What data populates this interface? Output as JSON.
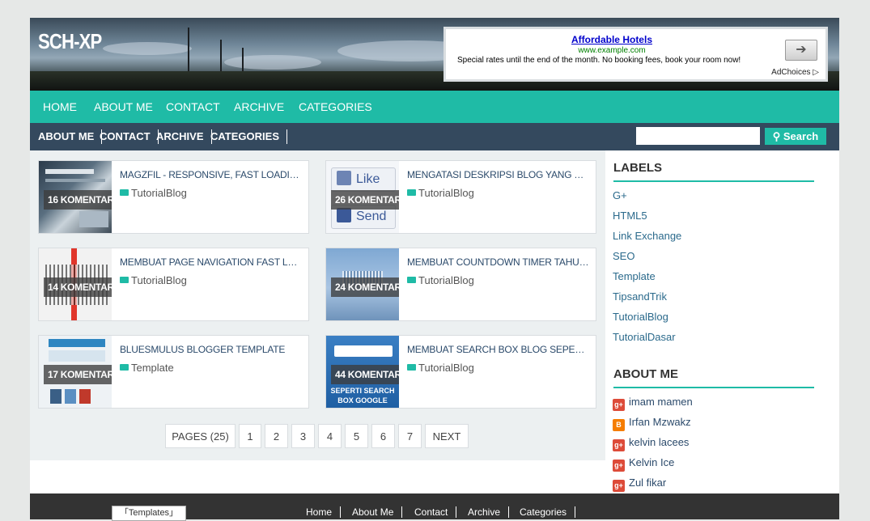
{
  "header": {
    "site_title": "SCH-XP",
    "ad": {
      "title": "Affordable Hotels",
      "url": "www.example.com",
      "description": "Special rates until the end of the month. No booking fees, book your room now!",
      "choices": "AdChoices"
    }
  },
  "nav_primary": [
    "HOME",
    "ABOUT ME",
    "CONTACT",
    "ARCHIVE",
    "CATEGORIES"
  ],
  "nav_secondary": [
    "ABOUT ME",
    "CONTACT",
    "ARCHIVE",
    "CATEGORIES"
  ],
  "search": {
    "placeholder": "",
    "button_label": "Search"
  },
  "posts": [
    {
      "title": "MAGZFIL - RESPONSIVE, FAST LOADING, SE...",
      "comments": "16 KOMENTAR",
      "label": "TutorialBlog"
    },
    {
      "title": "MENGATASI DESKRIPSI BLOG YANG TIDAK...",
      "comments": "26 KOMENTAR",
      "label": "TutorialBlog",
      "thumb_like": "Like",
      "thumb_send": "Send"
    },
    {
      "title": "MEMBUAT PAGE NAVIGATION FAST LOAD",
      "comments": "14 KOMENTAR",
      "label": "TutorialBlog"
    },
    {
      "title": "MEMBUAT COUNTDOWN TIMER TAHUN BA...",
      "comments": "24 KOMENTAR",
      "label": "TutorialBlog"
    },
    {
      "title": "BLUESMULUS BLOGGER TEMPLATE",
      "comments": "17 KOMENTAR",
      "label": "Template"
    },
    {
      "title": "MEMBUAT SEARCH BOX BLOG SEPERTI SE...",
      "comments": "44 KOMENTAR",
      "label": "TutorialBlog",
      "thumb_caption": "SEPERTI SEARCH BOX GOOGLE"
    }
  ],
  "pagination": {
    "pages_label": "PAGES (25)",
    "numbers": [
      "1",
      "2",
      "3",
      "4",
      "5",
      "6",
      "7"
    ],
    "next": "NEXT"
  },
  "sidebar": {
    "labels_title": "LABELS",
    "labels": [
      "G+",
      "HTML5",
      "Link Exchange",
      "SEO",
      "Template",
      "TipsandTrik",
      "TutorialBlog",
      "TutorialDasar"
    ],
    "about_title": "ABOUT ME",
    "authors": [
      {
        "name": "imam mamen",
        "icon": "google-plus-icon"
      },
      {
        "name": "Irfan Mzwakz",
        "icon": "blogger-icon"
      },
      {
        "name": "kelvin lacees",
        "icon": "google-plus-icon"
      },
      {
        "name": "Kelvin Ice",
        "icon": "google-plus-icon"
      },
      {
        "name": "Zul fikar",
        "icon": "google-plus-icon"
      }
    ]
  },
  "footer": {
    "badge": "「Templates」",
    "links": [
      "Home",
      "About Me",
      "Contact",
      "Archive",
      "Categories"
    ]
  },
  "colors": {
    "accent": "#1fbba6",
    "nav_dark": "#34495e",
    "footer": "#333333",
    "background": "#e6e8e7"
  }
}
